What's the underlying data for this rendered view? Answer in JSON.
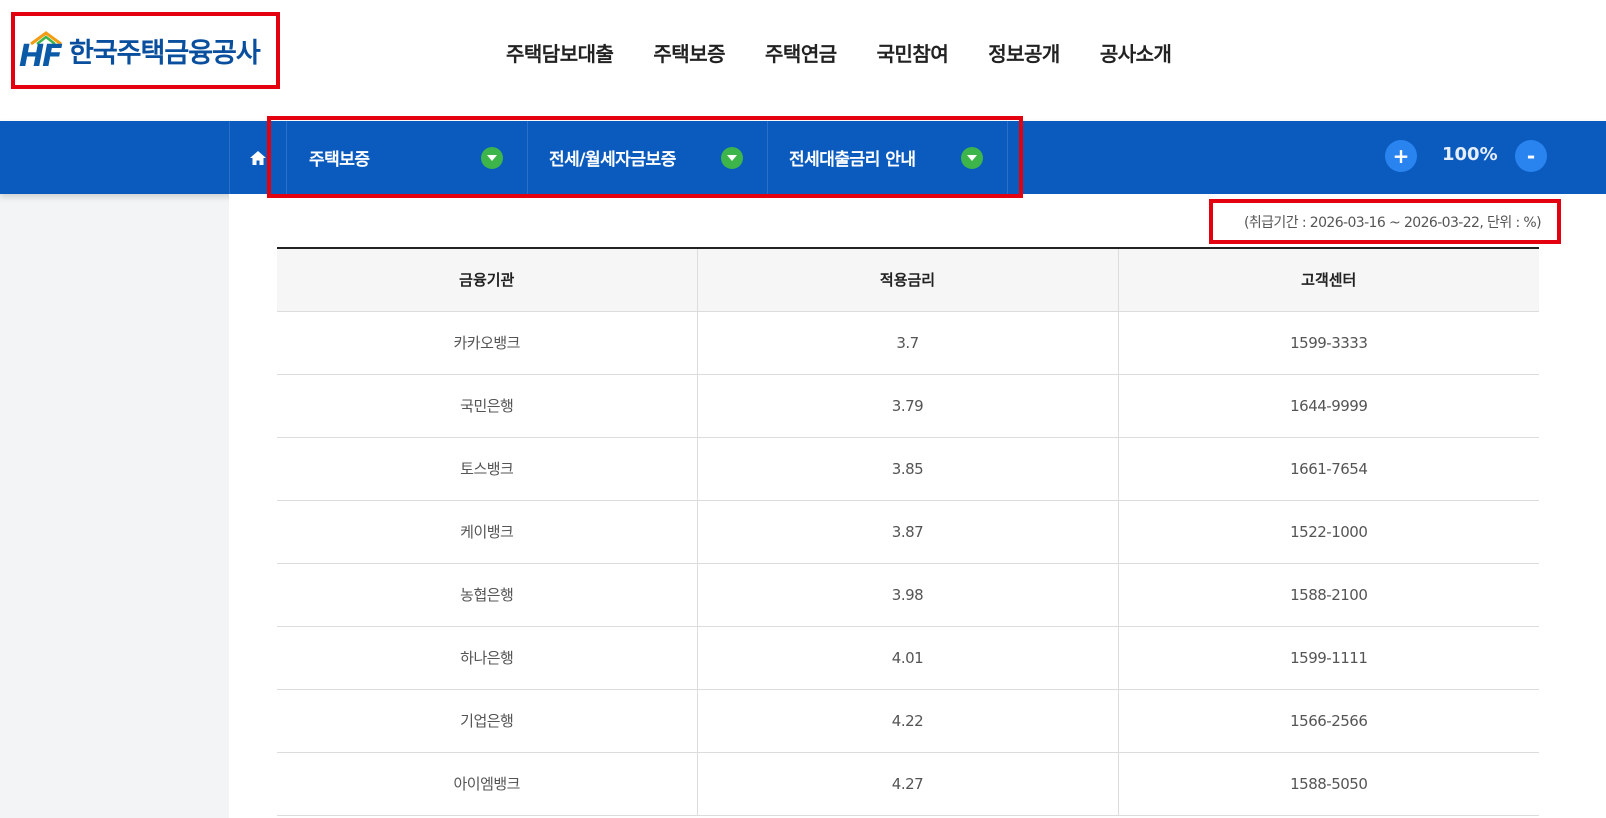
{
  "header": {
    "logo_mark": "HF",
    "logo_text": "한국주택금융공사",
    "nav": [
      "주택담보대출",
      "주택보증",
      "주택연금",
      "국민참여",
      "정보공개",
      "공사소개"
    ]
  },
  "breadcrumb": {
    "home_icon": "home-icon",
    "items": [
      "주택보증",
      "전세/월세자금보증",
      "전세대출금리 안내"
    ]
  },
  "zoom": {
    "plus": "+",
    "level": "100%",
    "minus": "-"
  },
  "period": "(취급기간 : 2026-03-16 ~ 2026-03-22, 단위 : %)",
  "table": {
    "headers": [
      "금융기관",
      "적용금리",
      "고객센터"
    ],
    "rows": [
      [
        "카카오뱅크",
        "3.7",
        "1599-3333"
      ],
      [
        "국민은행",
        "3.79",
        "1644-9999"
      ],
      [
        "토스뱅크",
        "3.85",
        "1661-7654"
      ],
      [
        "케이뱅크",
        "3.87",
        "1522-1000"
      ],
      [
        "농협은행",
        "3.98",
        "1588-2100"
      ],
      [
        "하나은행",
        "4.01",
        "1599-1111"
      ],
      [
        "기업은행",
        "4.22",
        "1566-2566"
      ],
      [
        "아이엠뱅크",
        "4.27",
        "1588-5050"
      ]
    ]
  },
  "colors": {
    "brand_blue": "#0b5bbf",
    "highlight_red": "#e3000f",
    "arrow_green": "#3db54a",
    "zoom_button": "#2a84f0"
  }
}
